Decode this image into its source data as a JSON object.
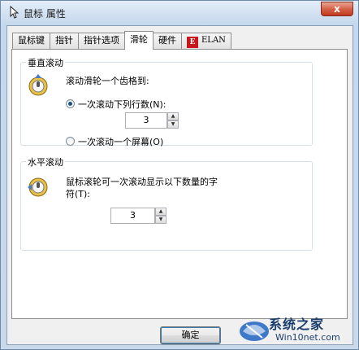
{
  "window": {
    "title": "鼠标 属性",
    "close_symbol": "x"
  },
  "tabs": [
    {
      "label": "鼠标键",
      "active": false
    },
    {
      "label": "指针",
      "active": false
    },
    {
      "label": "指针选项",
      "active": false
    },
    {
      "label": "滑轮",
      "active": true
    },
    {
      "label": "硬件",
      "active": false
    },
    {
      "label": "ELAN",
      "active": false,
      "icon": "elan-logo-icon"
    }
  ],
  "vertical": {
    "group_label": "垂直滚动",
    "description": "滚动滑轮一个齿格到:",
    "option_lines": "一次滚动下列行数(N):",
    "lines_value": "3",
    "option_screen": "一次滚动一个屏幕(O)",
    "selected": "lines"
  },
  "horizontal": {
    "group_label": "水平滚动",
    "description_line1": "鼠标滚轮可一次滚动显示以下数量的字",
    "description_line2": "符(T):",
    "chars_value": "3"
  },
  "buttons": {
    "ok_label": "确定"
  },
  "watermark": {
    "line1": "系统之家",
    "line2": "Win10net.com"
  },
  "colors": {
    "title_bg": "#c9d9ea",
    "close_red": "#c0391f",
    "panel_bg": "#ffffff",
    "elan_red": "#c8161d"
  }
}
